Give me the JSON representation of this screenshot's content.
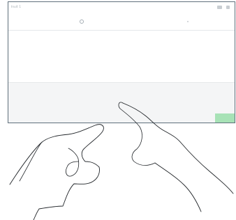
{
  "status_bar": {
    "device_label": "Inuit 1",
    "icons": [
      "signal-icon",
      "battery-icon"
    ]
  },
  "search": {
    "placeholder": ""
  },
  "message": {
    "lines": [
      "",
      "",
      ""
    ]
  },
  "keyboard": {
    "rows": [
      [
        "",
        "",
        "",
        "",
        "",
        "",
        "",
        "",
        "",
        "",
        "",
        "",
        "",
        ""
      ],
      [
        "",
        "",
        "",
        "",
        "",
        "",
        "",
        "",
        "",
        "",
        "",
        "",
        ""
      ],
      [
        "",
        "",
        "",
        "",
        "",
        "",
        "",
        "",
        "",
        "",
        "",
        ""
      ],
      [
        "",
        "",
        "",
        "",
        "",
        ""
      ]
    ],
    "enter_label": ""
  },
  "colors": {
    "enter_key": "#a7e2b6",
    "frame": "#5f6f7b"
  }
}
